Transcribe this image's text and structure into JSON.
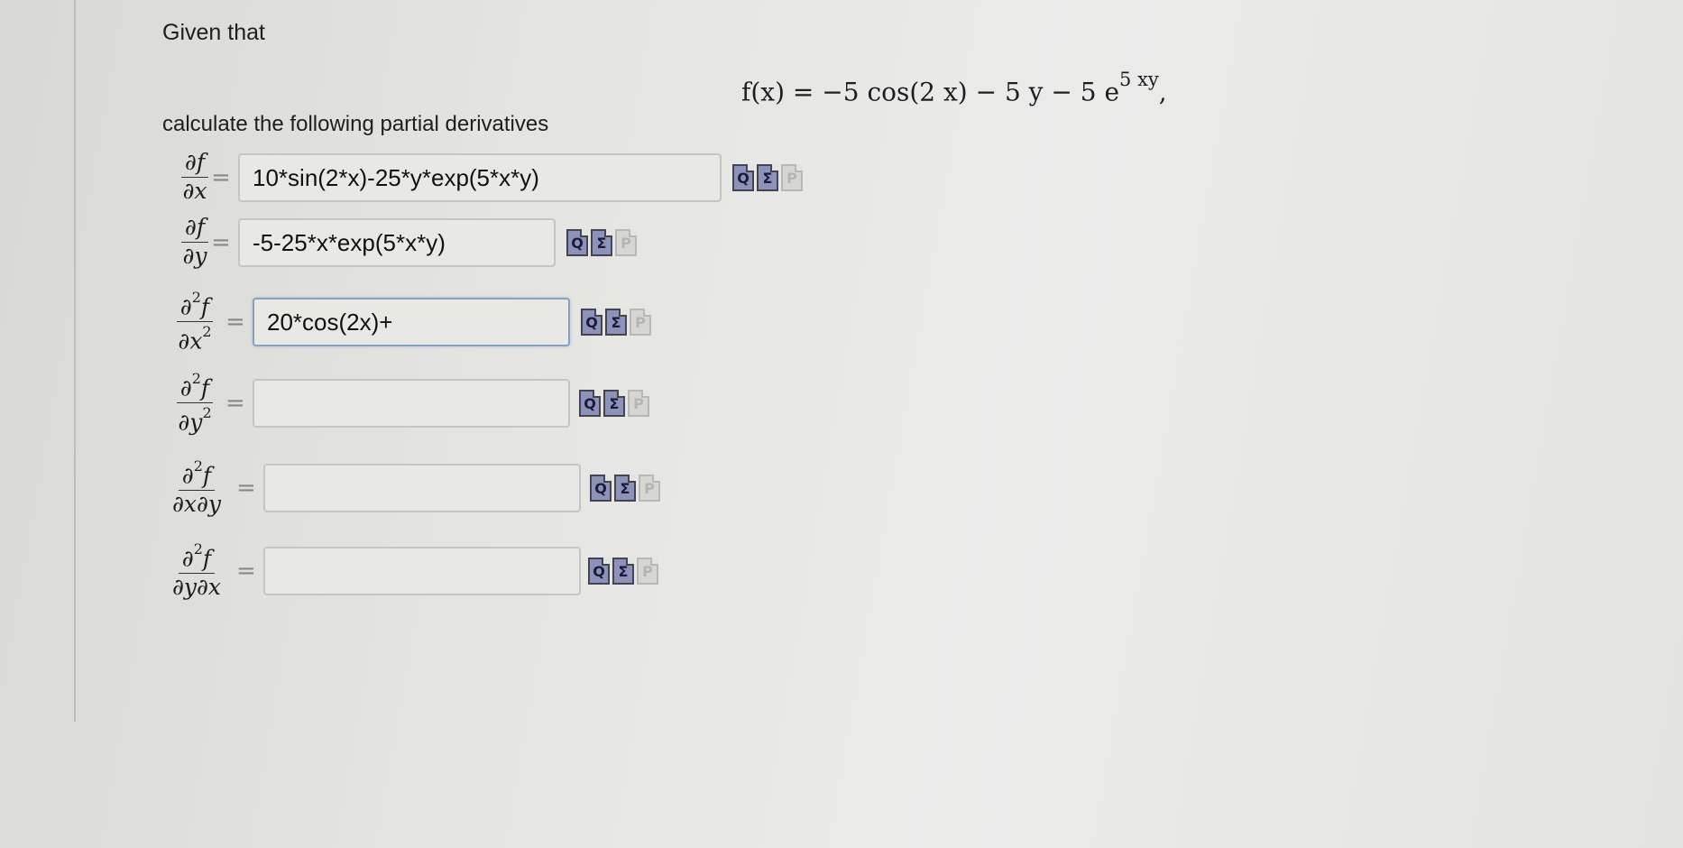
{
  "intro": "Given that",
  "formula": {
    "lhs": "f(x) = −5 cos(2 x) − 5 y − 5 e",
    "exponent": "5 xy",
    "trail": ","
  },
  "instruction": "calculate the following partial derivatives",
  "rows": [
    {
      "num": "∂f",
      "num_sup": "",
      "den": "∂x",
      "den_sup": "",
      "value": "10*sin(2*x)-25*y*exp(5*x*y)"
    },
    {
      "num": "∂f",
      "num_sup": "",
      "den": "∂y",
      "den_sup": "",
      "value": "-5-25*x*exp(5*x*y)"
    },
    {
      "num": "∂",
      "num_sup": "2",
      "num_tail": "f",
      "den": "∂x",
      "den_sup": "2",
      "value": "20*cos(2x)+"
    },
    {
      "num": "∂",
      "num_sup": "2",
      "num_tail": "f",
      "den": "∂y",
      "den_sup": "2",
      "value": ""
    },
    {
      "num": "∂",
      "num_sup": "2",
      "num_tail": "f",
      "den": "∂x∂y",
      "den_sup": "",
      "value": ""
    },
    {
      "num": "∂",
      "num_sup": "2",
      "num_tail": "f",
      "den": "∂y∂x",
      "den_sup": "",
      "value": ""
    }
  ],
  "equals": "=",
  "icons": {
    "preview": "Q",
    "sigma": "Σ",
    "p": "P"
  }
}
